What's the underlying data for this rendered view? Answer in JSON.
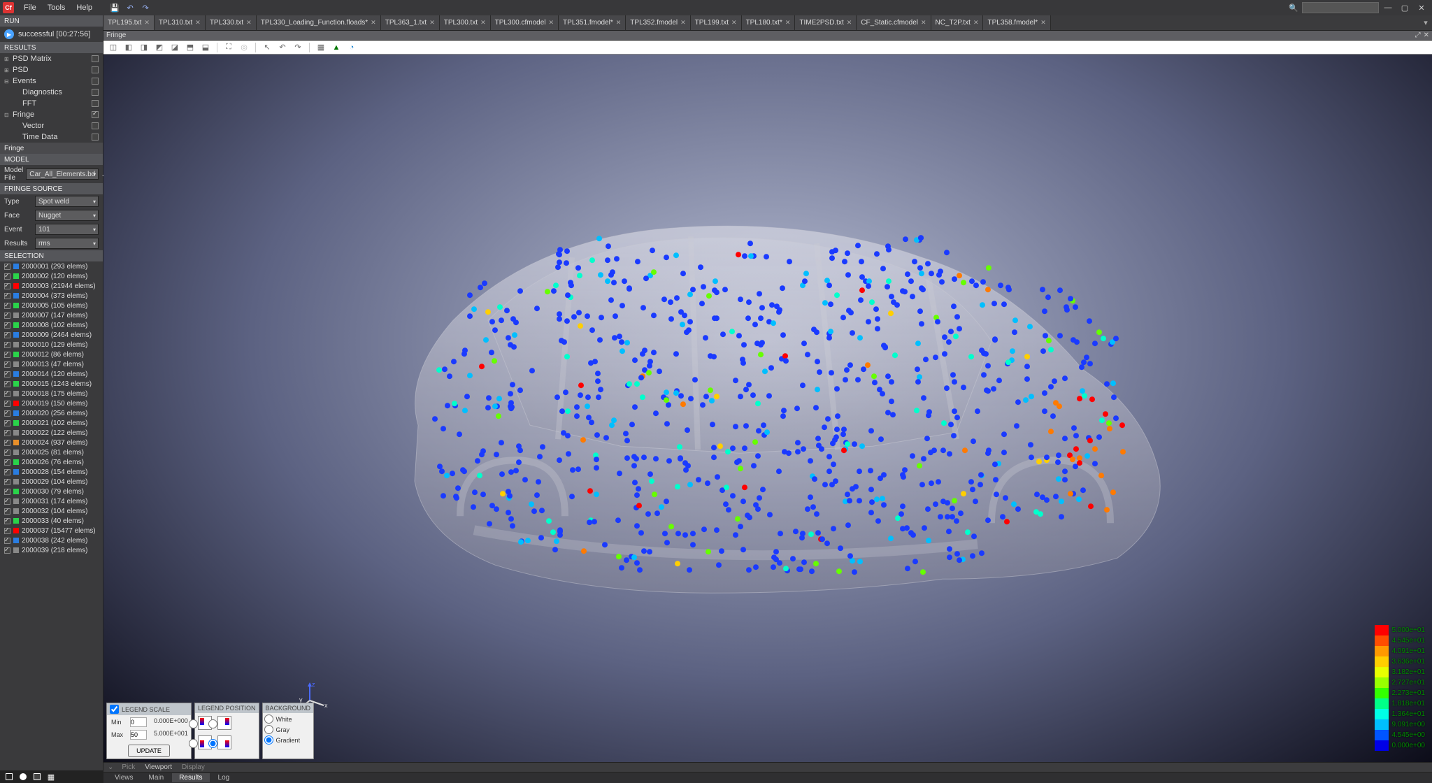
{
  "menu": {
    "items": [
      "File",
      "Tools",
      "Help"
    ]
  },
  "run": {
    "header": "RUN",
    "status": "successful [00:27:56]"
  },
  "results": {
    "header": "RESULTS",
    "items": [
      {
        "label": "PSD Matrix",
        "exp": "⊞",
        "checked": false,
        "indent": 0
      },
      {
        "label": "PSD",
        "exp": "⊞",
        "checked": false,
        "indent": 0
      },
      {
        "label": "Events",
        "exp": "⊟",
        "checked": false,
        "indent": 0
      },
      {
        "label": "Diagnostics",
        "exp": "",
        "checked": false,
        "indent": 1
      },
      {
        "label": "FFT",
        "exp": "",
        "checked": false,
        "indent": 1
      },
      {
        "label": "Fringe",
        "exp": "⊟",
        "checked": true,
        "indent": 0
      },
      {
        "label": "Vector",
        "exp": "",
        "checked": false,
        "indent": 1
      },
      {
        "label": "Time Data",
        "exp": "",
        "checked": false,
        "indent": 1
      }
    ]
  },
  "fringe_hdr": "Fringe",
  "model": {
    "header": "MODEL",
    "label": "Model File",
    "value": "Car_All_Elements.bd"
  },
  "source": {
    "header": "FRINGE SOURCE",
    "rows": [
      {
        "label": "Type",
        "value": "Spot weld"
      },
      {
        "label": "Face",
        "value": "Nugget"
      },
      {
        "label": "Event",
        "value": "101"
      },
      {
        "label": "Results",
        "value": "rms"
      }
    ]
  },
  "selection": {
    "header": "SELECTION",
    "items": [
      {
        "id": "2000001",
        "count": "293",
        "color": "#2a7de1"
      },
      {
        "id": "2000002",
        "count": "120",
        "color": "#2ad34a"
      },
      {
        "id": "2000003",
        "count": "21944",
        "color": "#f00"
      },
      {
        "id": "2000004",
        "count": "373",
        "color": "#2a7de1"
      },
      {
        "id": "2000005",
        "count": "105",
        "color": "#2ad34a"
      },
      {
        "id": "2000007",
        "count": "147",
        "color": "#888"
      },
      {
        "id": "2000008",
        "count": "102",
        "color": "#2ad34a"
      },
      {
        "id": "2000009",
        "count": "2464",
        "color": "#2a7de1"
      },
      {
        "id": "2000010",
        "count": "129",
        "color": "#888"
      },
      {
        "id": "2000012",
        "count": "86",
        "color": "#2ad34a"
      },
      {
        "id": "2000013",
        "count": "47",
        "color": "#888"
      },
      {
        "id": "2000014",
        "count": "120",
        "color": "#2a7de1"
      },
      {
        "id": "2000015",
        "count": "1243",
        "color": "#2ad34a"
      },
      {
        "id": "2000018",
        "count": "175",
        "color": "#888"
      },
      {
        "id": "2000019",
        "count": "150",
        "color": "#f00"
      },
      {
        "id": "2000020",
        "count": "256",
        "color": "#2a7de1"
      },
      {
        "id": "2000021",
        "count": "102",
        "color": "#2ad34a"
      },
      {
        "id": "2000022",
        "count": "122",
        "color": "#888"
      },
      {
        "id": "2000024",
        "count": "937",
        "color": "#e88f2a"
      },
      {
        "id": "2000025",
        "count": "81",
        "color": "#888"
      },
      {
        "id": "2000026",
        "count": "76",
        "color": "#2ad34a"
      },
      {
        "id": "2000028",
        "count": "154",
        "color": "#2a7de1"
      },
      {
        "id": "2000029",
        "count": "104",
        "color": "#888"
      },
      {
        "id": "2000030",
        "count": "79",
        "color": "#2ad34a"
      },
      {
        "id": "2000031",
        "count": "174",
        "color": "#888"
      },
      {
        "id": "2000032",
        "count": "104",
        "color": "#888"
      },
      {
        "id": "2000033",
        "count": "40",
        "color": "#2ad34a"
      },
      {
        "id": "2000037",
        "count": "15477",
        "color": "#f00"
      },
      {
        "id": "2000038",
        "count": "242",
        "color": "#2a7de1"
      },
      {
        "id": "2000039",
        "count": "218",
        "color": "#888"
      }
    ],
    "elems_label": "elems"
  },
  "tabs": [
    {
      "label": "TPL195.txt",
      "active": true
    },
    {
      "label": "TPL310.txt",
      "active": false
    },
    {
      "label": "TPL330.txt",
      "active": false
    },
    {
      "label": "TPL330_Loading_Function.floads*",
      "active": false
    },
    {
      "label": "TPL363_1.txt",
      "active": false
    },
    {
      "label": "TPL300.txt",
      "active": false
    },
    {
      "label": "TPL300.cfmodel",
      "active": false
    },
    {
      "label": "TPL351.fmodel*",
      "active": false
    },
    {
      "label": "TPL352.fmodel",
      "active": false
    },
    {
      "label": "TPL199.txt",
      "active": false
    },
    {
      "label": "TPL180.txt*",
      "active": false
    },
    {
      "label": "TIME2PSD.txt",
      "active": false
    },
    {
      "label": "CF_Static.cfmodel",
      "active": false
    },
    {
      "label": "NC_T2P.txt",
      "active": false
    },
    {
      "label": "TPL358.fmodel*",
      "active": false
    }
  ],
  "subtitle": "Fringe",
  "legend_scale": {
    "header": "LEGEND SCALE",
    "min_label": "Min",
    "min_val": "0",
    "min_sci": "0.000E+000",
    "max_label": "Max",
    "max_val": "50",
    "max_sci": "5.000E+001",
    "update": "UPDATE"
  },
  "legend_pos": {
    "header": "LEGEND POSITION"
  },
  "background": {
    "header": "BACKGROUND",
    "options": [
      "White",
      "Gray",
      "Gradient"
    ],
    "selected": 2
  },
  "status": {
    "items": [
      "Pick",
      "Viewport",
      "Display"
    ],
    "active": 1
  },
  "bottom_tabs": {
    "items": [
      "Views",
      "Main",
      "Results",
      "Log"
    ],
    "active": 2
  },
  "legend_values": [
    "5.000e+01",
    "4.545e+01",
    "4.091e+01",
    "3.636e+01",
    "3.182e+01",
    "2.727e+01",
    "2.273e+01",
    "1.818e+01",
    "1.364e+01",
    "9.091e+00",
    "4.545e+00",
    "0.000e+00"
  ],
  "legend_colors": [
    "#ff0000",
    "#ff4d00",
    "#ff9900",
    "#ffcf00",
    "#e8ff00",
    "#99ff00",
    "#33ff00",
    "#00ff88",
    "#00ffe6",
    "#00bfff",
    "#0055ff",
    "#0000e6"
  ]
}
